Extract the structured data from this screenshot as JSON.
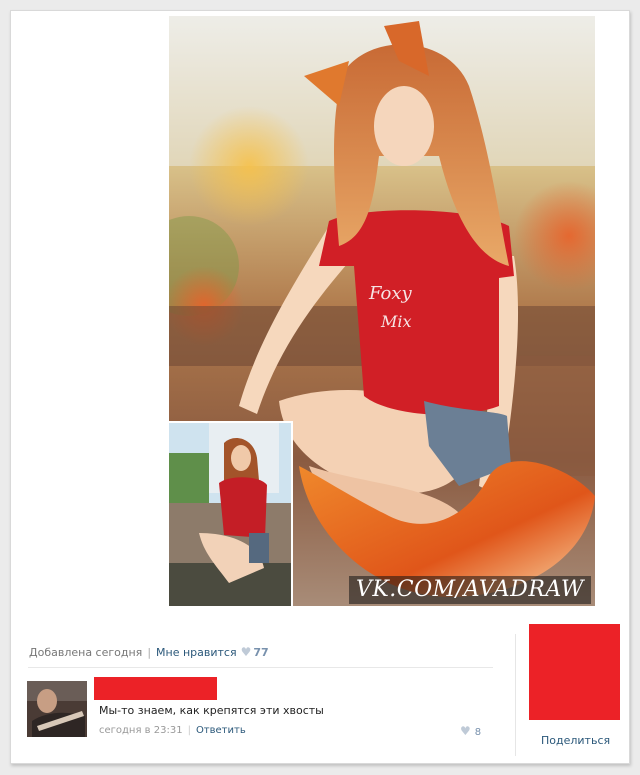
{
  "post": {
    "watermark": "VK.COM/AVADRAW",
    "shirt_text": [
      "Foxy",
      "Mix"
    ]
  },
  "meta": {
    "added": "Добавлена сегодня",
    "like_label": "Мне нравится",
    "like_count": "77"
  },
  "comment": {
    "text": "Мы-то знаем, как крепятся эти хвосты",
    "time": "сегодня в 23:31",
    "reply_label": "Ответить",
    "like_count": "8"
  },
  "share": {
    "label": "Поделиться"
  },
  "colors": {
    "accent_red": "#ec2227",
    "link_blue": "#2b587a",
    "like_gray": "#7891ad"
  },
  "icons": [
    "heart-icon"
  ]
}
